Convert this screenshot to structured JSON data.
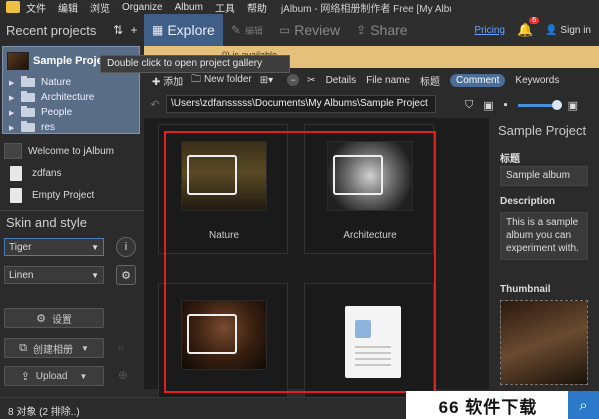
{
  "menubar": {
    "items": [
      "文件",
      "编辑",
      "浏览",
      "Organize",
      "Album",
      "工具",
      "帮助"
    ],
    "window_title": "jAlbum - 网络相册制作者 Free [My Albums\\Sample ..."
  },
  "left": {
    "recent_title": "Recent projects",
    "project_name": "Sample Project",
    "tree": [
      "Nature",
      "Architecture",
      "People",
      "res"
    ],
    "other_projects": [
      "Welcome to jAlbum",
      "zdfans",
      "Empty Project"
    ],
    "skin_title": "Skin and style",
    "skin_value": "Tiger",
    "style_value": "Linen",
    "settings_label": "设置",
    "make_album_label": "创建相册",
    "upload_label": "Upload"
  },
  "tabs": {
    "explore": "Explore",
    "edit": "编辑",
    "review": "Review",
    "share": "Share",
    "pricing": "Pricing",
    "notif_count": "6",
    "signin": "Sign in"
  },
  "notice": "0) is available",
  "tooltip": "Double click to open project gallery",
  "toolbar": {
    "add": "添加",
    "new_folder": "New folder",
    "details": "Details",
    "file_name": "File name",
    "title": "标题",
    "comment": "Comment",
    "keywords": "Keywords"
  },
  "path": "\\Users\\zdfansssss\\Documents\\My Albums\\Sample Project",
  "gallery": {
    "tiles": [
      {
        "caption": "Nature"
      },
      {
        "caption": "Architecture"
      },
      {
        "caption": ""
      },
      {
        "caption": ""
      }
    ]
  },
  "right": {
    "title": "Sample Project",
    "title_label": "标题",
    "title_value": "Sample album",
    "desc_label": "Description",
    "desc_value": "This is a sample album you can experiment with.",
    "thumb_label": "Thumbnail"
  },
  "status": "8 对象 (2 排除..)",
  "watermark": "66 软件下载",
  "colors": {
    "accent": "#3f5f86",
    "highlight_border": "#e02020",
    "notice_bg": "#e5c07a"
  }
}
